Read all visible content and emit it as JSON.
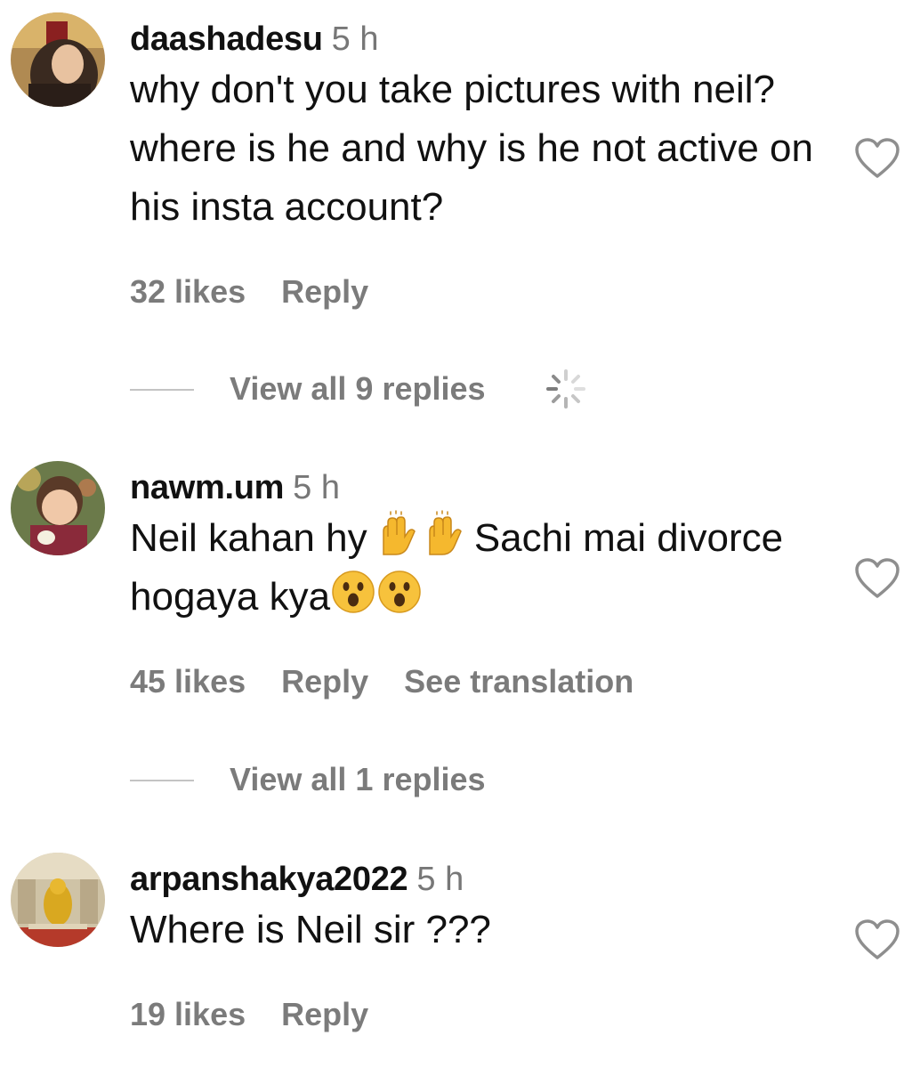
{
  "comments": [
    {
      "username": "daashadesu",
      "time": "5 h",
      "text": "why don't you take pictures with neil? where is he and why is he not active on his insta account?",
      "likes": "32 likes",
      "reply_label": "Reply",
      "view_replies": "View all 9 replies",
      "loading": true
    },
    {
      "username": "nawm.um",
      "time": "5 h",
      "text_parts": [
        "Neil kahan hy ",
        "Sachi mai divorce hogaya kya"
      ],
      "likes": "45 likes",
      "reply_label": "Reply",
      "see_translation": "See translation",
      "view_replies": "View all 1 replies"
    },
    {
      "username": "arpanshakya2022",
      "time": "5 h",
      "text": "Where is Neil sir ???",
      "likes": "19 likes",
      "reply_label": "Reply"
    }
  ],
  "icons": {
    "like": "heart-outline-icon",
    "loading": "spinner-icon",
    "emoji_1": "raising-hands-emoji",
    "emoji_2": "astonished-face-emoji"
  },
  "colors": {
    "text": "#111111",
    "muted": "#7b7b7b",
    "timestamp": "#777777",
    "divider": "#c4c4c4"
  }
}
